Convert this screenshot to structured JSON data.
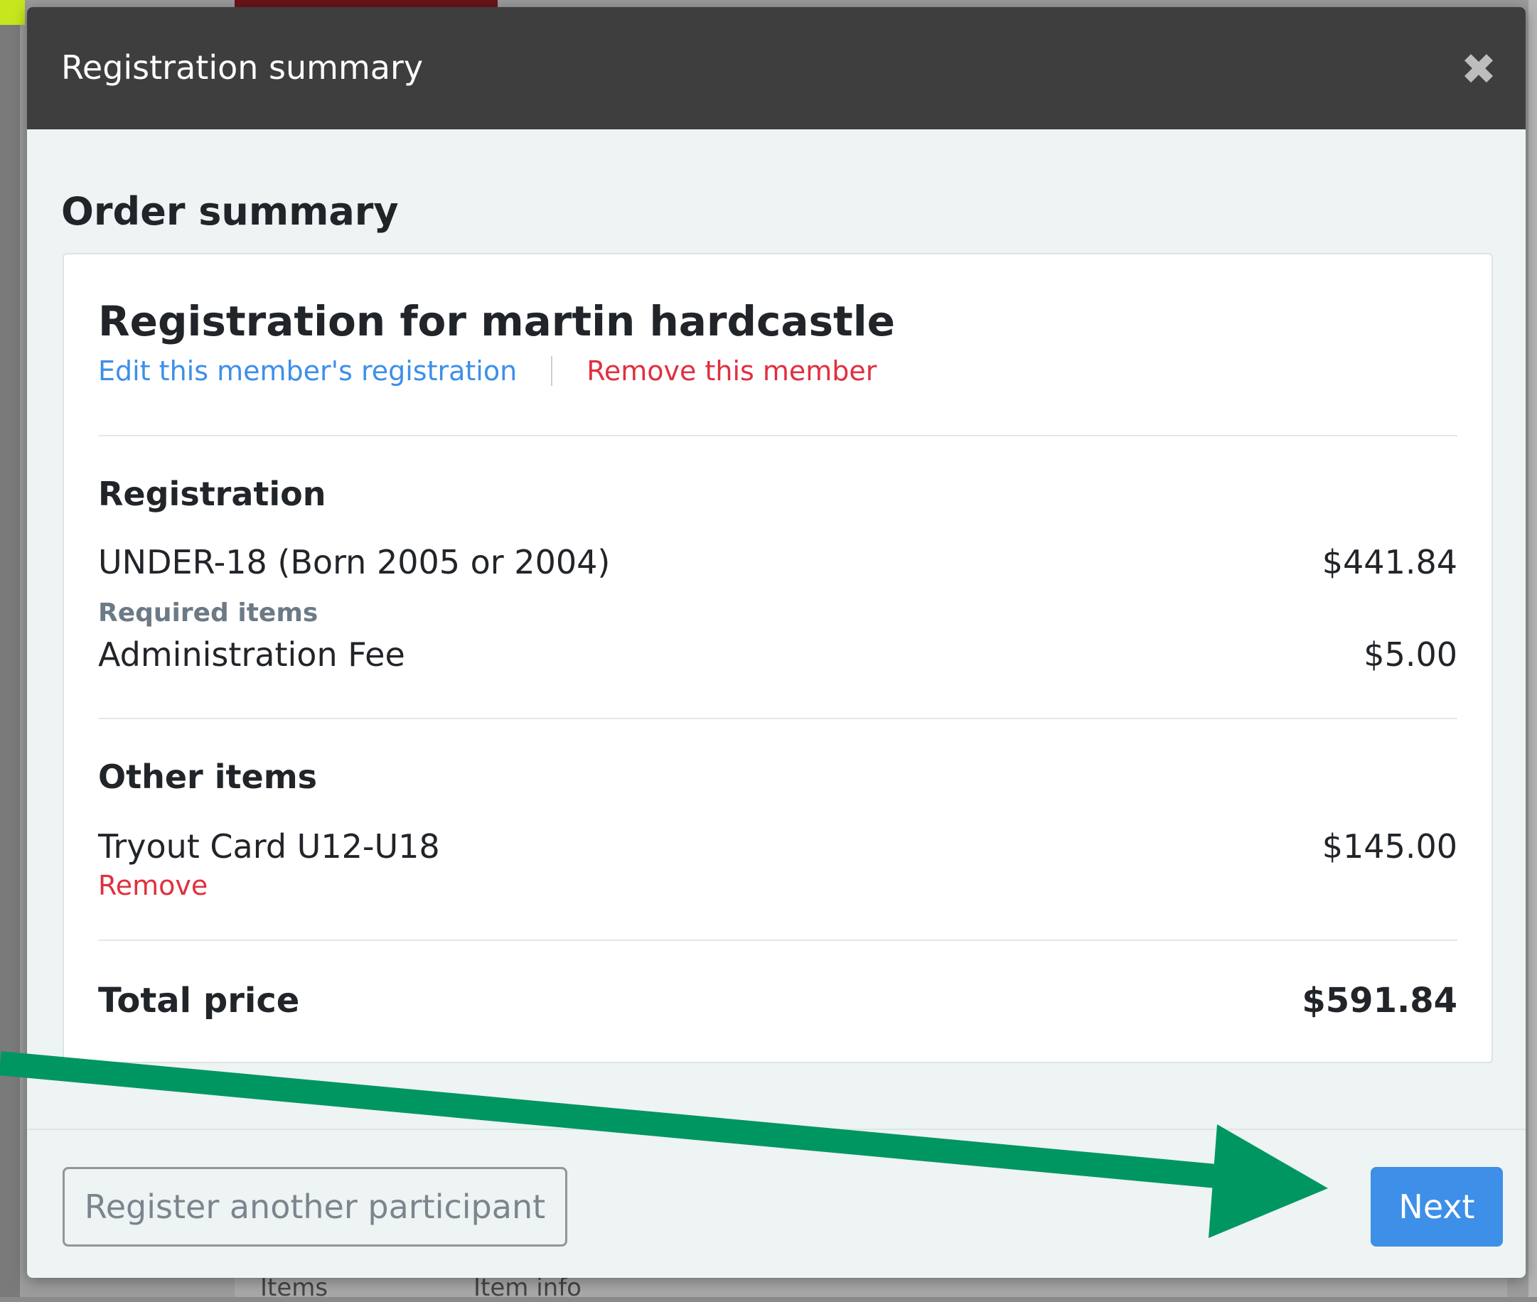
{
  "background": {
    "columns": [
      "Items",
      "Item info"
    ]
  },
  "modal": {
    "title": "Registration summary",
    "close_icon": "close-icon"
  },
  "order": {
    "heading": "Order summary",
    "member_title": "Registration for martin hardcastle",
    "edit_link": "Edit this member's registration",
    "remove_member_link": "Remove this member",
    "registration": {
      "heading": "Registration",
      "item_name": "UNDER-18 (Born 2005 or 2004)",
      "item_price": "$441.84",
      "required_label": "Required items",
      "required_item_name": "Administration Fee",
      "required_item_price": "$5.00"
    },
    "other": {
      "heading": "Other items",
      "item_name": "Tryout Card U12-U18",
      "item_price": "$145.00",
      "remove_label": "Remove"
    },
    "total": {
      "label": "Total price",
      "value": "$591.84"
    }
  },
  "footer": {
    "secondary_button": "Register another participant",
    "primary_button": "Next"
  },
  "colors": {
    "link_blue": "#3d8fe8",
    "danger_red": "#e0303f",
    "arrow_green": "#009662",
    "header_dark": "#3e3e3e"
  }
}
